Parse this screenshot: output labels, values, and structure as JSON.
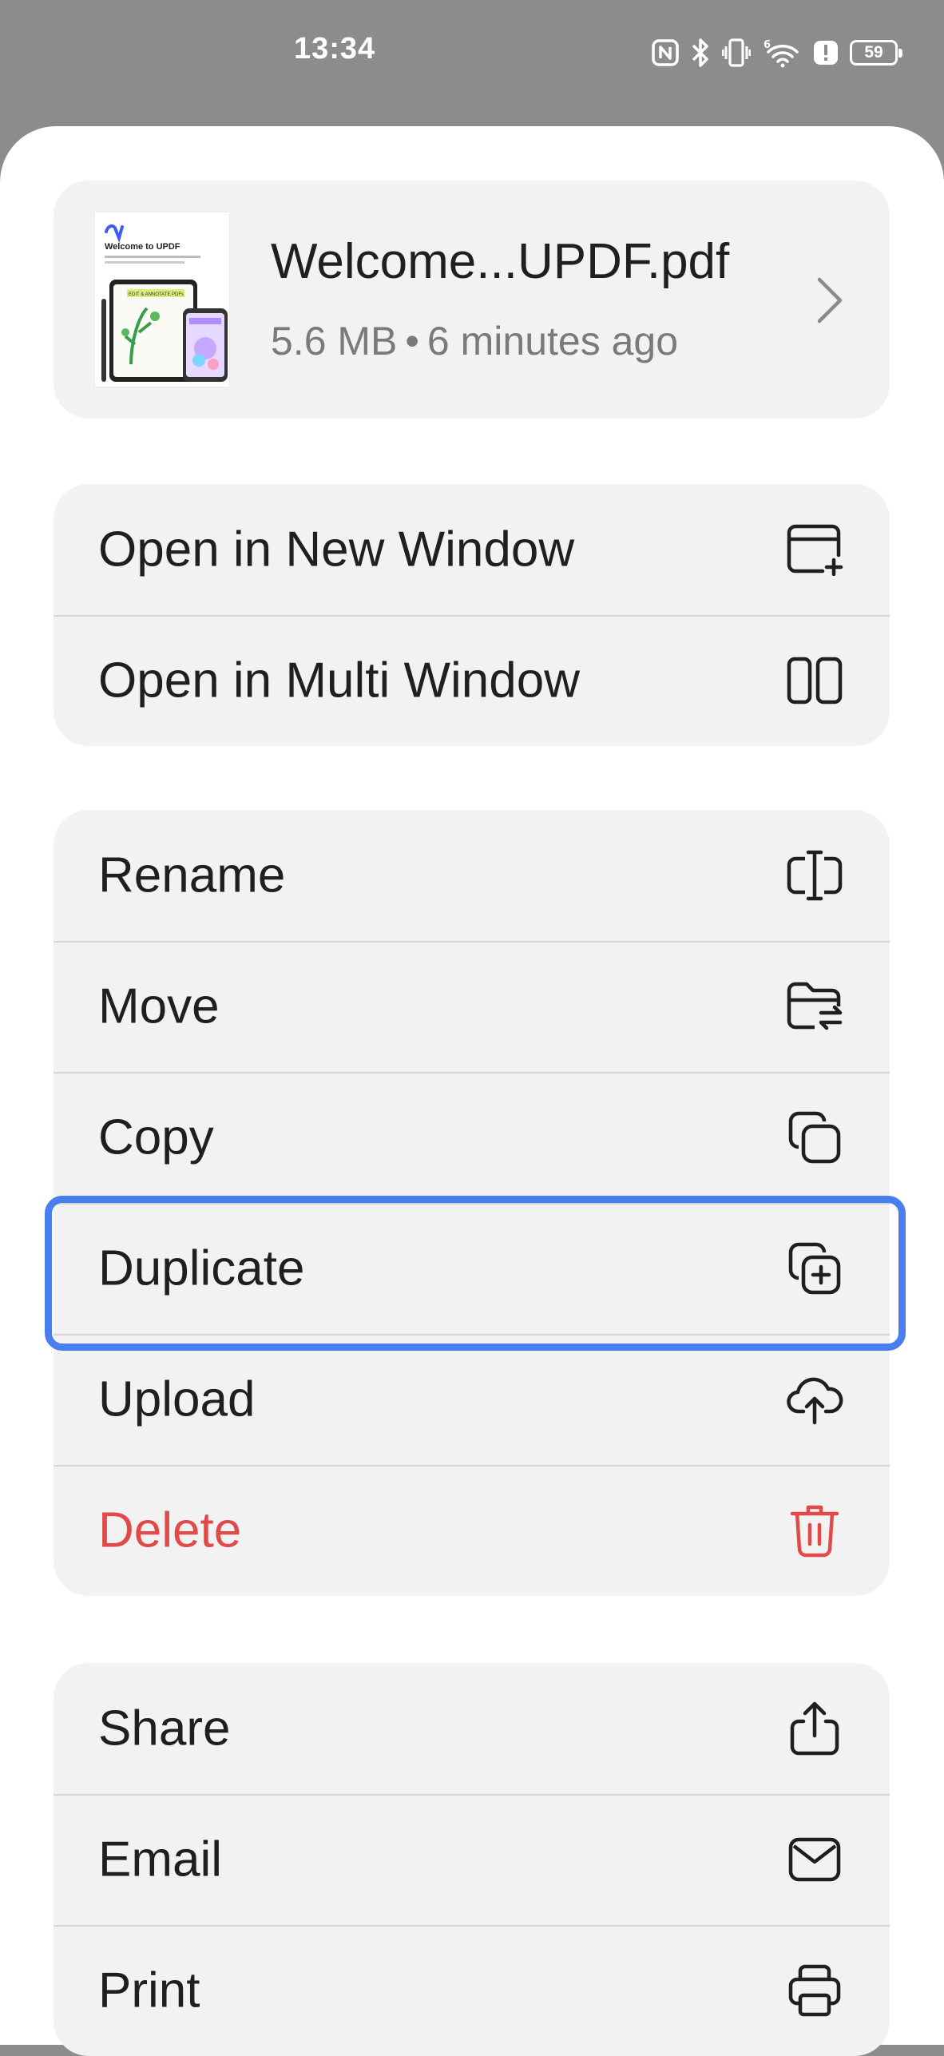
{
  "status_bar": {
    "time": "13:34",
    "battery_level": "59",
    "icons": [
      "nfc-icon",
      "bluetooth-icon",
      "vibrate-icon",
      "wifi-6-icon",
      "alert-icon",
      "battery-icon"
    ]
  },
  "file": {
    "name": "Welcome...UPDF.pdf",
    "size": "5.6 MB",
    "separator": "•",
    "modified": "6 minutes ago",
    "thumbnail_title": "Welcome to UPDF",
    "thumbnail_banner": "EDIT & ANNOTATE PDFs"
  },
  "groups": {
    "window": [
      {
        "label": "Open in New Window",
        "icon": "new-window-icon"
      },
      {
        "label": "Open in Multi Window",
        "icon": "multi-window-icon"
      }
    ],
    "file_ops": [
      {
        "label": "Rename",
        "icon": "rename-icon"
      },
      {
        "label": "Move",
        "icon": "move-folder-icon"
      },
      {
        "label": "Copy",
        "icon": "copy-icon"
      },
      {
        "label": "Duplicate",
        "icon": "duplicate-icon",
        "highlighted": true
      },
      {
        "label": "Upload",
        "icon": "cloud-upload-icon"
      },
      {
        "label": "Delete",
        "icon": "trash-icon",
        "color": "#e24a4a"
      }
    ],
    "share": [
      {
        "label": "Share",
        "icon": "share-icon"
      },
      {
        "label": "Email",
        "icon": "email-icon"
      },
      {
        "label": "Print",
        "icon": "print-icon"
      }
    ]
  },
  "colors": {
    "highlight": "#4a7ef0",
    "danger": "#e24a4a",
    "card_background": "#f2f2f2"
  }
}
